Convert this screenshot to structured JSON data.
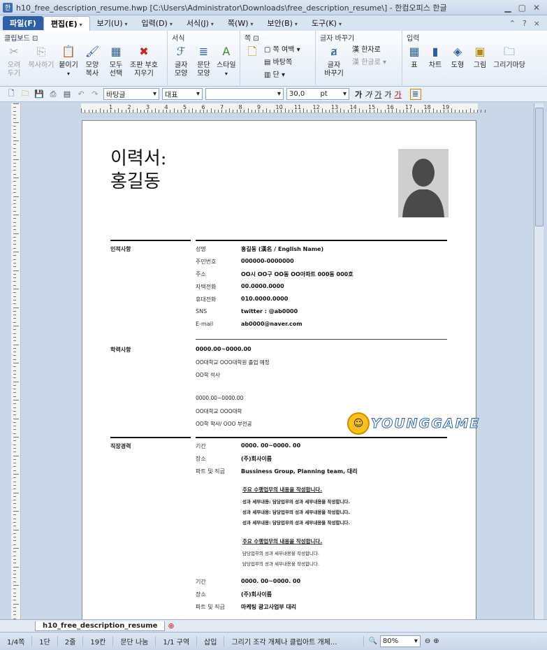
{
  "window": {
    "app_icon": "hwp-icon",
    "title": "h10_free_description_resume.hwp [C:\\Users\\Administrator\\Downloads\\free_description_resume\\] - 한컴오피스 한글",
    "min": "▁",
    "max": "▢",
    "close": "✕"
  },
  "menu": {
    "items": [
      "파일(F)",
      "편집(E)",
      "보기(U)",
      "입력(D)",
      "서식(J)",
      "쪽(W)",
      "보안(B)",
      "도구(K)"
    ],
    "right": [
      "?",
      "×"
    ]
  },
  "ribbon": {
    "groups": [
      {
        "name": "클립보드 ⊡",
        "buttons": [
          "오려\n두기",
          "복사하기",
          "붙이기",
          "모양\n복사",
          "모두\n선택",
          "조판 부호\n지우기"
        ]
      },
      {
        "name": "서식",
        "buttons": [
          "글자\n모양",
          "문단\n모양",
          "스타일"
        ]
      },
      {
        "name": "쪽 ⊡",
        "small": [
          "쪽 여백",
          "바탕쪽",
          "단"
        ]
      },
      {
        "name": "글자 바꾸기",
        "buttons": [
          "글자\n바꾸기"
        ],
        "small": [
          "한자로",
          "한글로"
        ]
      },
      {
        "name": "입력",
        "buttons": [
          "표",
          "차트",
          "도형",
          "그림",
          "그리기마당"
        ]
      }
    ]
  },
  "toolbar": {
    "style_combo": "바탕글",
    "font_kind": "대표",
    "font_name": "",
    "size": "30,0",
    "unit": "pt",
    "format_btns": [
      "가",
      "가",
      "가",
      "가",
      "가"
    ]
  },
  "ruler": {
    "labels": [
      "1",
      "2",
      "3",
      "4",
      "5",
      "6",
      "7",
      "8",
      "9",
      "10",
      "11",
      "12",
      "13",
      "14",
      "15",
      "16",
      "17",
      "18",
      "19"
    ]
  },
  "document": {
    "title_line1": "이력서:",
    "title_line2": "홍길동",
    "personal": {
      "section": "인적사항",
      "rows": [
        {
          "k": "성명",
          "v": "홍길동 (漢名 / English Name)"
        },
        {
          "k": "주민번호",
          "v": "000000-0000000"
        },
        {
          "k": "주소",
          "v": "OO시 OO구 OO동 OO아파트 000동 000호"
        },
        {
          "k": "자택전화",
          "v": "00.0000.0000"
        },
        {
          "k": "휴대전화",
          "v": "010.0000.0000"
        },
        {
          "k": "SNS",
          "v": "twitter : @ab0000"
        },
        {
          "k": "E-mail",
          "v": "ab0000@naver.com"
        }
      ]
    },
    "education": {
      "section": "학력사항",
      "lines": [
        "0000.00~0000.00",
        "OO대학교 OOO대학원 졸업 예정",
        "OO학 석사",
        "",
        "0000.00~0000.00",
        "OO대학교 OOO대학",
        "OO학 학사/ OOO 부전공"
      ]
    },
    "career": {
      "section": "직장경력",
      "rows": [
        {
          "k": "기간",
          "v": "0000. 00~0000. 00"
        },
        {
          "k": "장소",
          "v": "(주)회사이름"
        },
        {
          "k": "파트 및 직급",
          "v": "Bussiness Group, Planning team, 대리"
        }
      ],
      "duty_title": "주요 수행업무의 내용을 작성합니다.",
      "duty_lines": [
        "성과 세부내용: 담당업무의 성과 세부내용을 작성합니다.",
        "성과 세부내용: 담당업무의 성과 세부내용을 작성합니다.",
        "성과 세부내용: 담당업무의 성과 세부내용을 작성합니다."
      ],
      "duty_title2": "주요 수행업무의 내용을 작성합니다.",
      "duty_lines2": [
        "담당업무의 성과 세부내용을 작성합니다.",
        "담당업무의 성과 세부내용을 작성합니다."
      ],
      "rows2": [
        {
          "k": "기간",
          "v": "0000. 00~0000. 00"
        },
        {
          "k": "장소",
          "v": "(주)회사이름"
        },
        {
          "k": "파트 및 직급",
          "v": "마케팅 광고사업부 대리"
        }
      ]
    },
    "watermark": "YOUNGGAME"
  },
  "tabs": {
    "doc_tab": "h10_free_description_resume"
  },
  "status": [
    "1/4쪽",
    "1단",
    "2줄",
    "19칸",
    "문단 나눔",
    "1/1 구역",
    "삽입",
    "그리기 조각 개체나 클립아트 개체...",
    "80%"
  ]
}
